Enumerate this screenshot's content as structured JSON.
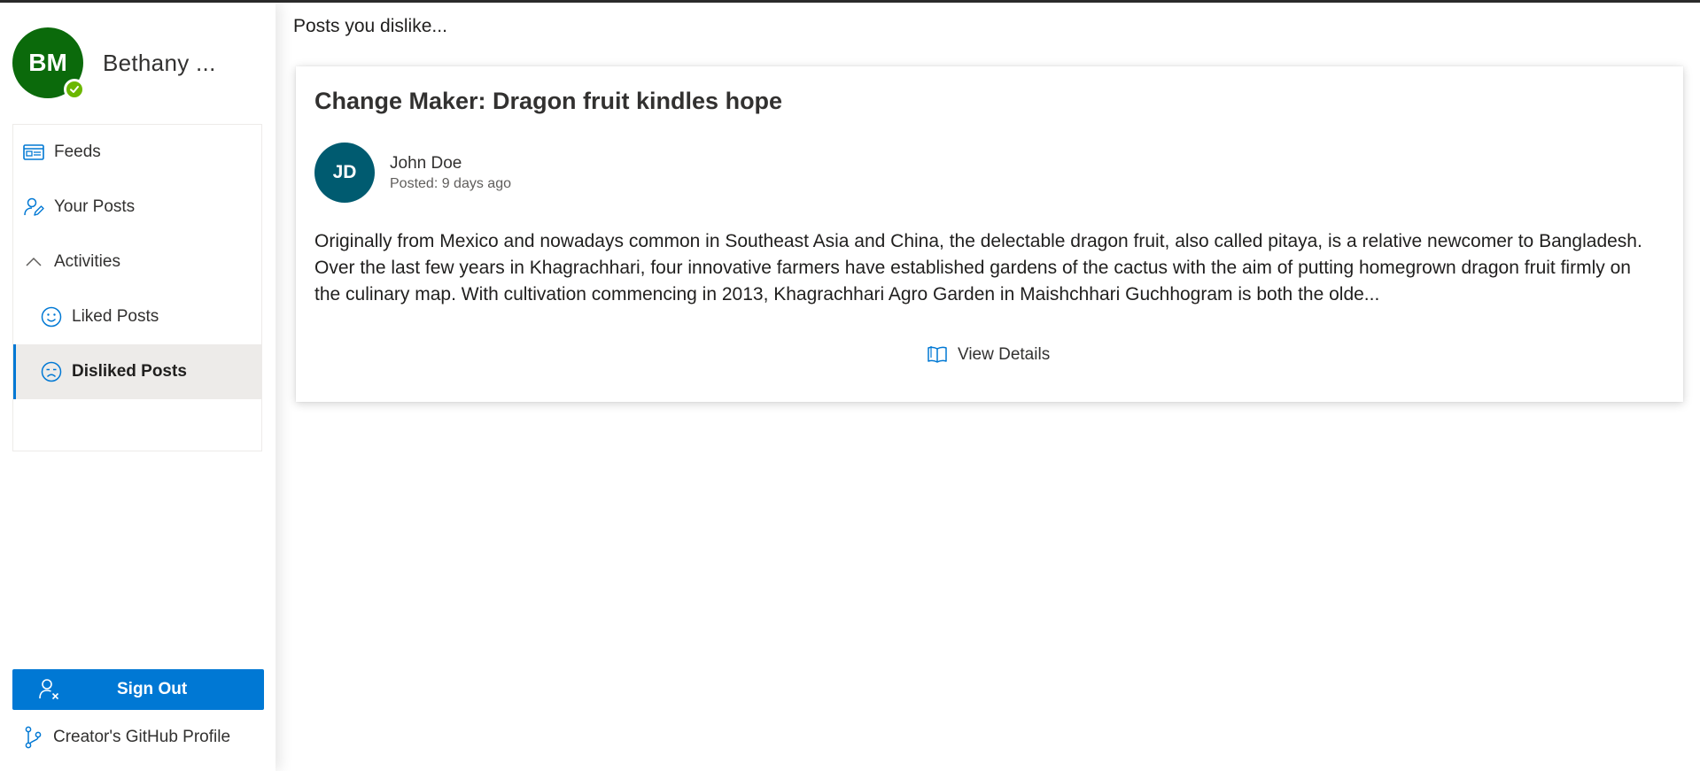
{
  "profile": {
    "initials": "BM",
    "name": "Bethany ...",
    "status": "available"
  },
  "nav": {
    "feeds": "Feeds",
    "your_posts": "Your Posts",
    "activities": "Activities",
    "liked_posts": "Liked Posts",
    "disliked_posts": "Disliked Posts",
    "selected": "Disliked Posts"
  },
  "footer": {
    "sign_out": "Sign Out",
    "github": "Creator's GitHub Profile"
  },
  "main": {
    "heading": "Posts you dislike...",
    "post": {
      "title": "Change Maker: Dragon fruit kindles hope",
      "author_initials": "JD",
      "author_name": "John Doe",
      "posted": "Posted: 9 days ago",
      "body": "Originally from Mexico and nowadays common in Southeast Asia and China, the delectable dragon fruit, also called pitaya, is a relative newcomer to Bangladesh. Over the last few years in Khagrachhari, four innovative farmers have established gardens of the cactus with the aim of putting homegrown dragon fruit firmly on the culinary map. With cultivation commencing in 2013, Khagrachhari Agro Garden in Maishchhari Guchhogram is both the olde...",
      "view_details": "View Details"
    }
  },
  "colors": {
    "accent": "#0078d4",
    "profile_avatar": "#0b6a0b",
    "author_avatar": "#005b70",
    "presence": "#6bb700",
    "selected_bg": "#edebe9"
  },
  "icons": {
    "feeds": "news-icon",
    "your_posts": "person-edit-icon",
    "activities": "chevron-up-icon",
    "liked_posts": "smiley-icon",
    "disliked_posts": "sad-face-icon",
    "sign_out": "person-remove-icon",
    "github": "branch-icon",
    "view_details": "book-icon",
    "presence": "check-icon"
  }
}
